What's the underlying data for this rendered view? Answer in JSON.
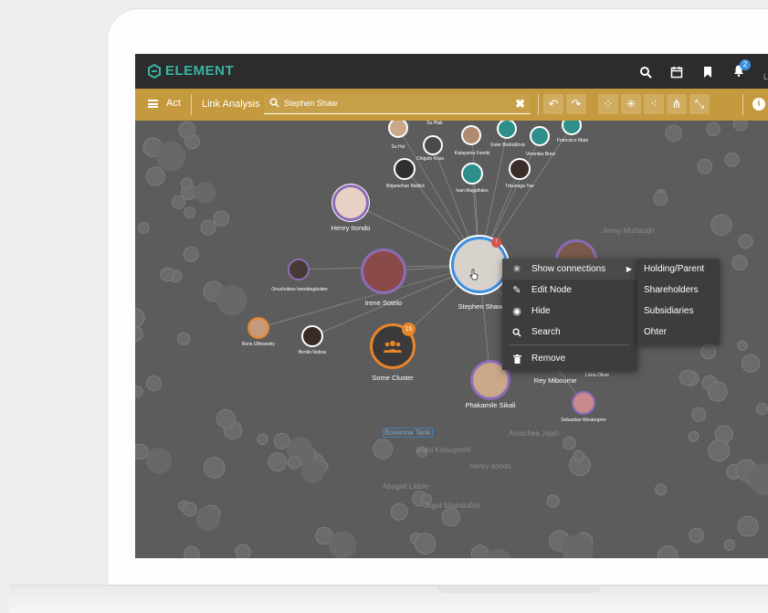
{
  "app": {
    "brand": "ELEMENT"
  },
  "header": {
    "icons": [
      "search-icon",
      "calendar-icon",
      "bookmark-icon",
      "bell-icon"
    ],
    "notification_count": "2",
    "user_initial": "L"
  },
  "toolbar": {
    "menu_label": "Act",
    "module_title": "Link Analysis",
    "search_value": "Stephen Shaw",
    "clear_glyph": "✖",
    "tools": [
      "undo-icon",
      "redo-icon",
      "graph-layout-icon",
      "star-layout-icon",
      "cluster-layout-icon",
      "hierarchy-layout-icon",
      "diagonal-layout-icon"
    ],
    "info_glyph": "i"
  },
  "graph": {
    "main_nodes": {
      "focus": "Stephen Shaw",
      "henry": "Henry Itondo",
      "irene": "Irene Sotelo",
      "cluster": "Some Cluster",
      "cluster_count": "15",
      "rey": "Rey Mibourne",
      "phakamile": "Phakamile Sikali",
      "sebastian": "Sebastian Westergren",
      "lisha": "Lisha Oliver"
    },
    "small_nodes": {
      "su_ptak": "Su Ptak",
      "su_hoi": "Su Hoi",
      "chiguto": "Chiguto Kosa",
      "katayama": "Katayama Fumiki",
      "ester": "Ester Bednářová",
      "veronika": "Veronika Brew",
      "francisco": "Francisco Mata",
      "brijamohan": "Brijamohan Mallick",
      "ivan": "Ivan Magalhães",
      "tokunaga": "Tokunaga Yae",
      "onuchukwu": "Onuchukwu Iweobiegbulam",
      "boris": "Boris Ulfmansky",
      "benito": "Benito Noboa",
      "jenny": "Jenny Murtaugh",
      "amachea": "Amachea Jajah",
      "henry_b": "Henry Itondo",
      "izumi": "Izumi Katsuyoshi",
      "abagail": "Abagail Libbie",
      "jagat": "Jagat Shahdullah",
      "bovenna": "Bovenna Tank"
    }
  },
  "context_menu": {
    "items": [
      {
        "label": "Show connections",
        "icon": "connections-icon"
      },
      {
        "label": "Edit Node",
        "icon": "pencil-icon"
      },
      {
        "label": "Hide",
        "icon": "eye-slash-icon"
      },
      {
        "label": "Search",
        "icon": "search-icon"
      },
      {
        "label": "Remove",
        "icon": "trash-icon"
      }
    ],
    "submenu": [
      "Holding/Parent",
      "Shareholders",
      "Subsidiaries",
      "Ohter"
    ]
  },
  "colors": {
    "header_bg": "#2c2c2c",
    "brand": "#39b3a3",
    "toolbar": "#c59a3e",
    "canvas": "#5c5c5c",
    "highlight_blue": "#3b8fe0",
    "cluster_orange": "#e8862a",
    "node_purple": "#8c6bb8",
    "node_teal": "#2e8f8a"
  }
}
